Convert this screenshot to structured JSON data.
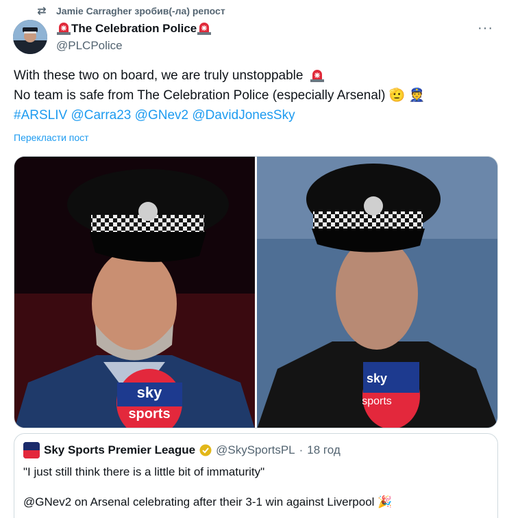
{
  "repost": {
    "text": "Jamie Carragher зробив(-ла) репост"
  },
  "author": {
    "name": "The Celebration Police",
    "handle": "@PLCPolice"
  },
  "tweet": {
    "line1": "With these two on board, we are truly unstoppable",
    "line2": "No team is safe from The Celebration Police (especially Arsenal)",
    "emoji_line2": "🫡 👮",
    "hashtag": "#ARSLIV",
    "mentions": [
      "@Carra23",
      "@GNev2",
      "@DavidJonesSky"
    ],
    "translate_label": "Перекласти пост"
  },
  "media": {
    "left_mic_top": "sky",
    "left_mic_bottom": "sports",
    "right_mic_top": "sky",
    "right_mic_bottom": "sports"
  },
  "quote": {
    "name": "Sky Sports Premier League",
    "handle": "@SkySportsPL",
    "separator": "·",
    "time": "18 год",
    "text1": "\"I just still think there is a little bit of immaturity\"",
    "text2": "@GNev2 on Arsenal celebrating after their 3-1 win against Liverpool",
    "text2_emoji": "🎉"
  },
  "colors": {
    "link": "#1d9bf0",
    "secondary": "#536471",
    "border": "#cfd9de"
  },
  "icons": [
    "retweet-icon",
    "siren-icon",
    "more-icon",
    "verified-badge-icon",
    "sky-sports-logo"
  ]
}
